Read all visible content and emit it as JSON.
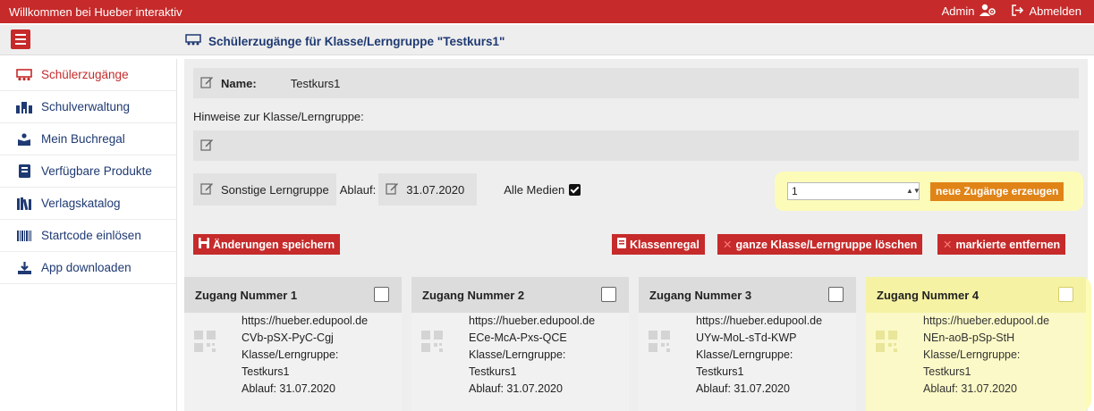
{
  "topbar": {
    "title": "Willkommen bei Hueber interaktiv",
    "admin_label": "Admin",
    "logout_label": "Abmelden"
  },
  "header": {
    "page_title": "Schülerzugänge für Klasse/Lerngruppe \"Testkurs1\""
  },
  "sidebar": {
    "items": [
      {
        "label": "Schülerzugänge",
        "icon": "class-icon",
        "active": true
      },
      {
        "label": "Schulverwaltung",
        "icon": "school-icon"
      },
      {
        "label": "Mein Buchregal",
        "icon": "bookshelf-user-icon"
      },
      {
        "label": "Verfügbare Produkte",
        "icon": "book-icon"
      },
      {
        "label": "Verlagskatalog",
        "icon": "books-icon"
      },
      {
        "label": "Startcode einlösen",
        "icon": "barcode-icon"
      },
      {
        "label": "App downloaden",
        "icon": "download-icon"
      }
    ]
  },
  "form": {
    "name_label": "Name:",
    "name_value": "Testkurs1",
    "hint_label": "Hinweise zur Klasse/Lerngruppe:",
    "group_type": "Sonstige Lerngruppe",
    "expiry_label": "Ablauf:",
    "expiry_value": "31.07.2020",
    "all_media_label": "Alle Medien",
    "count_value": "1",
    "generate_label": "neue Zugänge erzeugen",
    "save_label": "Änderungen speichern",
    "shelf_label": "Klassenregal",
    "delete_class_label": "ganze Klasse/Lerngruppe löschen",
    "remove_marked_label": "markierte entfernen"
  },
  "accesses": [
    {
      "title": "Zugang Nummer 1",
      "url": "https://hueber.edupool.de",
      "code": "CVb-pSX-PyC-Cgj",
      "group_label": "Klasse/Lerngruppe:",
      "group": "Testkurs1",
      "expiry": "Ablauf: 31.07.2020"
    },
    {
      "title": "Zugang Nummer 2",
      "url": "https://hueber.edupool.de",
      "code": "ECe-McA-Pxs-QCE",
      "group_label": "Klasse/Lerngruppe:",
      "group": "Testkurs1",
      "expiry": "Ablauf: 31.07.2020"
    },
    {
      "title": "Zugang Nummer 3",
      "url": "https://hueber.edupool.de",
      "code": "UYw-MoL-sTd-KWP",
      "group_label": "Klasse/Lerngruppe:",
      "group": "Testkurs1",
      "expiry": "Ablauf: 31.07.2020"
    },
    {
      "title": "Zugang Nummer 4",
      "url": "https://hueber.edupool.de",
      "code": "NEn-aoB-pSp-StH",
      "group_label": "Klasse/Lerngruppe:",
      "group": "Testkurs1",
      "expiry": "Ablauf: 31.07.2020",
      "highlighted": true
    }
  ],
  "colors": {
    "brand_red": "#c62a2a",
    "navy": "#1f3a72",
    "orange": "#e08417",
    "highlight": "#fdfbb8"
  }
}
